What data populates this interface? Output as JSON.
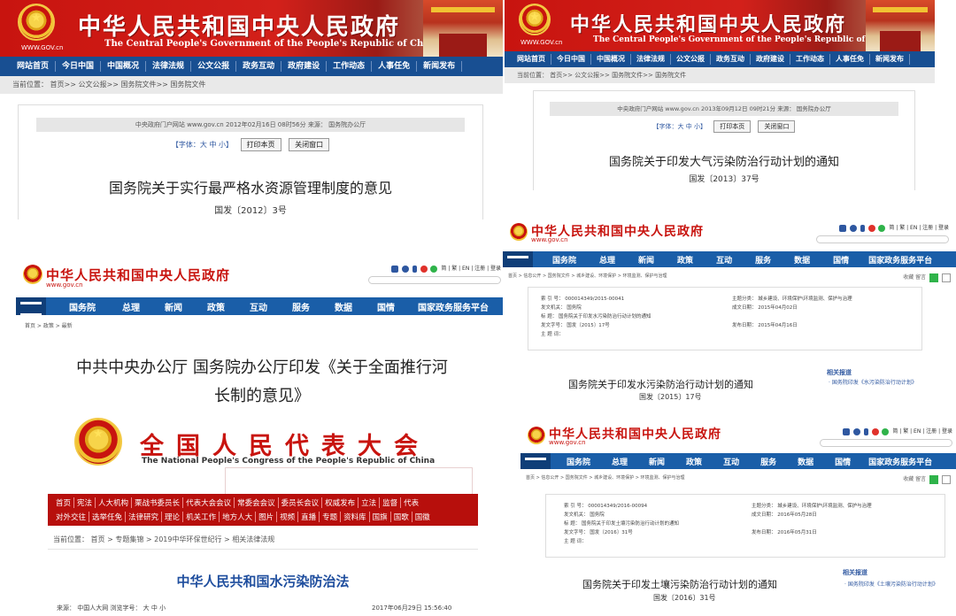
{
  "p1": {
    "title_cn": "中华人民共和国中央人民政府",
    "title_en": "The Central People's Government of the People's Republic of China",
    "domain": "WWW.GOV.cn",
    "nav": [
      "网站首页",
      "今日中国",
      "中国概况",
      "法律法规",
      "公文公报",
      "政务互动",
      "政府建设",
      "工作动态",
      "人事任免",
      "新闻发布"
    ],
    "crumb": "当前位置：  首页>>  公文公报>>  国务院文件>>  国务院文件",
    "meta": "中央政府门户网站   www.gov.cn      2012年02月16日  08时56分      来源：  国务院办公厅",
    "font_label": "【字体：大 中 小】",
    "print_btn": "打印本页",
    "close_btn": "关闭窗口",
    "doc_title": "国务院关于实行最严格水资源管理制度的意见",
    "doc_no": "国发〔2012〕3号"
  },
  "p2": {
    "title_cn": "中华人民共和国中央人民政府",
    "title_en": "The Central People's Government of the People's Republic of China",
    "domain": "WWW.GOV.cn",
    "nav": [
      "网站首页",
      "今日中国",
      "中国概况",
      "法律法规",
      "公文公报",
      "政务互动",
      "政府建设",
      "工作动态",
      "人事任免",
      "新闻发布"
    ],
    "crumb": "当前位置：  首页>>  公文公报>>  国务院文件>>  国务院文件",
    "meta": "中央政府门户网站   www.gov.cn      2013年09月12日  09时21分      来源：  国务院办公厅",
    "font_label": "【字体：大 中 小】",
    "print_btn": "打印本页",
    "close_btn": "关闭窗口",
    "doc_title": "国务院关于印发大气污染防治行动计划的通知",
    "doc_no": "国发〔2013〕37号"
  },
  "p3": {
    "title_cn": "中华人民共和国中央人民政府",
    "url": "www.gov.cn",
    "tools": "简 | 繁 | EN | 注册 | 登录",
    "nav": [
      "国务院",
      "总理",
      "新闻",
      "政策",
      "互动",
      "服务",
      "数据",
      "国情",
      "国家政务服务平台"
    ],
    "crumb": "首页  >  政策  >  最新",
    "doc_title_1": "中共中央办公厅 国务院办公厅印发《关于全面推行河",
    "doc_title_2": "长制的意见》"
  },
  "p4": {
    "title_cn": "中华人民共和国中央人民政府",
    "url": "www.gov.cn",
    "tools": "简 | 繁 | EN | 注册 | 登录",
    "nav": [
      "国务院",
      "总理",
      "新闻",
      "政策",
      "互动",
      "服务",
      "数据",
      "国情",
      "国家政务服务平台"
    ],
    "crumb": "首页  >  信息公开  >  国务院文件  >  城乡建设、环境保护  >  环境监测、保护与治理",
    "share": "收藏   留言",
    "meta": {
      "l1": "索 引 号：   000014349/2015-00041",
      "l2": "发文机关：   国务院",
      "l3": "标    题：   国务院关于印发水污染防治行动计划的通知",
      "l4": "发文字号：   国发〔2015〕17号",
      "l5": "主 题 词：",
      "r1": "主题分类：   城乡建设、环境保护\\环境监测、保护与治理",
      "r2": "成文日期：   2015年04月02日",
      "r3": "发布日期：   2015年04月16日"
    },
    "doc_title": "国务院关于印发水污染防治行动计划的通知",
    "doc_no": "国发〔2015〕17号",
    "related_h": "相关报道",
    "related_i": "· 国务院印发《水污染防治行动计划》"
  },
  "p5": {
    "title_cn": "全国人民代表大会",
    "title_en": "The National People's Congress of the People's Republic of China",
    "nav_row1": [
      "首页",
      "宪法",
      "人大机构",
      "栗战书委员长",
      "代表大会会议",
      "常委会会议",
      "委员长会议",
      "权威发布",
      "立法",
      "监督",
      "代表"
    ],
    "nav_row2": [
      "对外交往",
      "选举任免",
      "法律研究",
      "理论",
      "机关工作",
      "地方人大",
      "图片",
      "视频",
      "直播",
      "专题",
      "资料库",
      "国旗",
      "国歌",
      "国徽"
    ],
    "crumb": "当前位置：  首页  >  专题集锦  >  2019中华环保世纪行  >  相关法律法规",
    "doc_title": "中华人民共和国水污染防治法",
    "source": "来源：  中国人大网     浏览字号：  大  中  小",
    "date": "2017年06月29日  15:56:40"
  },
  "p6": {
    "title_cn": "中华人民共和国中央人民政府",
    "url": "www.gov.cn",
    "tools": "简 | 繁 | EN | 注册 | 登录",
    "nav": [
      "国务院",
      "总理",
      "新闻",
      "政策",
      "互动",
      "服务",
      "数据",
      "国情",
      "国家政务服务平台"
    ],
    "crumb": "首页  >  信息公开  >  国务院文件  >  城乡建设、环境保护  >  环境监测、保护与治理",
    "share": "收藏   留言",
    "meta": {
      "l1": "索 引 号：   000014349/2016-00094",
      "l2": "发文机关：   国务院",
      "l3": "标    题：   国务院关于印发土壤污染防治行动计划的通知",
      "l4": "发文字号：   国发〔2016〕31号",
      "l5": "主 题 词：",
      "r1": "主题分类：   城乡建设、环境保护\\环境监测、保护与治理",
      "r2": "成文日期：   2016年05月28日",
      "r3": "发布日期：   2016年05月31日"
    },
    "doc_title": "国务院关于印发土壤污染防治行动计划的通知",
    "doc_no": "国发〔2016〕31号",
    "related_h": "相关报道",
    "related_i": "· 国务院印发《土壤污染防治行动计划》"
  }
}
